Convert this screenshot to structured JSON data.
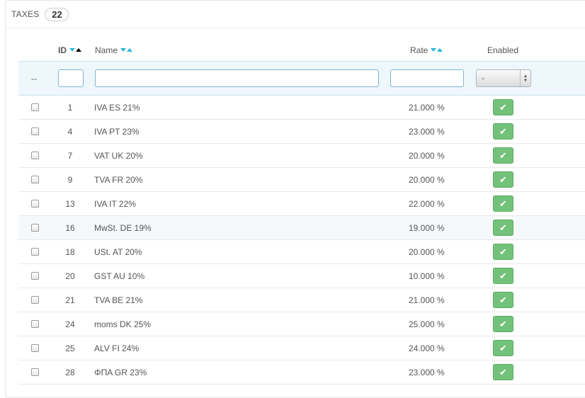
{
  "header": {
    "title": "Taxes",
    "count": "22"
  },
  "columns": {
    "id": "ID",
    "name": "Name",
    "rate": "Rate",
    "enabled": "Enabled"
  },
  "filter": {
    "bulk_placeholder": "--",
    "enabled_select_value": "-"
  },
  "rows": [
    {
      "id": "1",
      "name": "IVA ES 21%",
      "rate": "21.000 %",
      "enabled": true
    },
    {
      "id": "4",
      "name": "IVA PT 23%",
      "rate": "23.000 %",
      "enabled": true
    },
    {
      "id": "7",
      "name": "VAT UK 20%",
      "rate": "20.000 %",
      "enabled": true
    },
    {
      "id": "9",
      "name": "TVA FR 20%",
      "rate": "20.000 %",
      "enabled": true
    },
    {
      "id": "13",
      "name": "IVA IT 22%",
      "rate": "22.000 %",
      "enabled": true
    },
    {
      "id": "16",
      "name": "MwSt. DE 19%",
      "rate": "19.000 %",
      "enabled": true
    },
    {
      "id": "18",
      "name": "USt. AT 20%",
      "rate": "20.000 %",
      "enabled": true
    },
    {
      "id": "20",
      "name": "GST AU 10%",
      "rate": "10.000 %",
      "enabled": true
    },
    {
      "id": "21",
      "name": "TVA BE 21%",
      "rate": "21.000 %",
      "enabled": true
    },
    {
      "id": "24",
      "name": "moms DK 25%",
      "rate": "25.000 %",
      "enabled": true
    },
    {
      "id": "25",
      "name": "ALV FI 24%",
      "rate": "24.000 %",
      "enabled": true
    },
    {
      "id": "28",
      "name": "ΦΠΑ GR 23%",
      "rate": "23.000 %",
      "enabled": true
    }
  ],
  "colors": {
    "accent": "#25b9d7",
    "enabled_green": "#72c279"
  },
  "icons": {
    "enabled": "check-icon"
  }
}
